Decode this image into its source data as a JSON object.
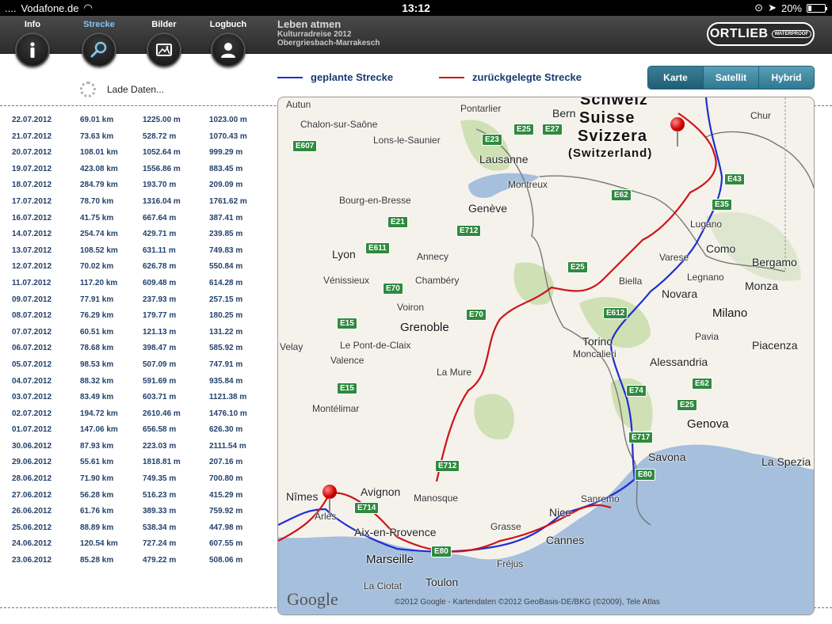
{
  "status": {
    "carrier": "Vodafone.de",
    "time": "13:12",
    "battery": "20%",
    "battery_level": 0.2
  },
  "tabs": [
    {
      "label": "Info",
      "icon": "info-icon"
    },
    {
      "label": "Strecke",
      "icon": "search-icon"
    },
    {
      "label": "Bilder",
      "icon": "pictures-icon"
    },
    {
      "label": "Logbuch",
      "icon": "person-icon"
    }
  ],
  "trip": {
    "title": "Leben atmen",
    "subtitle": "Kulturradreise 2012",
    "route": "Obergriesbach-Marrakesch"
  },
  "logo": {
    "brand": "ORTLIEB",
    "tag": "WATERPROOF"
  },
  "loading": "Lade Daten...",
  "legend": {
    "planned": "geplante Strecke",
    "traveled": "zurückgelegte Strecke",
    "planned_color": "#1f2fd0",
    "traveled_color": "#d0121a"
  },
  "map_types": [
    "Karte",
    "Satellit",
    "Hybrid"
  ],
  "log": [
    [
      "22.07.2012",
      "69.01 km",
      "1225.00 m",
      "1023.00 m"
    ],
    [
      "21.07.2012",
      "73.63 km",
      "528.72 m",
      "1070.43 m"
    ],
    [
      "20.07.2012",
      "108.01 km",
      "1052.64 m",
      "999.29 m"
    ],
    [
      "19.07.2012",
      "423.08 km",
      "1556.86 m",
      "883.45 m"
    ],
    [
      "18.07.2012",
      "284.79 km",
      "193.70 m",
      "209.09 m"
    ],
    [
      "17.07.2012",
      "78.70 km",
      "1316.04 m",
      "1761.62 m"
    ],
    [
      "16.07.2012",
      "41.75 km",
      "667.64 m",
      "387.41 m"
    ],
    [
      "14.07.2012",
      "254.74 km",
      "429.71 m",
      "239.85 m"
    ],
    [
      "13.07.2012",
      "108.52 km",
      "631.11 m",
      "749.83 m"
    ],
    [
      "12.07.2012",
      "70.02 km",
      "626.78 m",
      "550.84 m"
    ],
    [
      "11.07.2012",
      "117.20 km",
      "609.48 m",
      "614.28 m"
    ],
    [
      "09.07.2012",
      "77.91 km",
      "237.93 m",
      "257.15 m"
    ],
    [
      "08.07.2012",
      "76.29 km",
      "179.77 m",
      "180.25 m"
    ],
    [
      "07.07.2012",
      "60.51 km",
      "121.13 m",
      "131.22 m"
    ],
    [
      "06.07.2012",
      "78.68 km",
      "398.47 m",
      "585.92 m"
    ],
    [
      "05.07.2012",
      "98.53 km",
      "507.09 m",
      "747.91 m"
    ],
    [
      "04.07.2012",
      "88.32 km",
      "591.69 m",
      "935.84 m"
    ],
    [
      "03.07.2012",
      "83.49 km",
      "603.71 m",
      "1121.38 m"
    ],
    [
      "02.07.2012",
      "194.72 km",
      "2610.46 m",
      "1476.10 m"
    ],
    [
      "01.07.2012",
      "147.06 km",
      "656.58 m",
      "626.30 m"
    ],
    [
      "30.06.2012",
      "87.93 km",
      "223.03 m",
      "2111.54 m"
    ],
    [
      "29.06.2012",
      "55.61 km",
      "1818.81 m",
      "207.16 m"
    ],
    [
      "28.06.2012",
      "71.90 km",
      "749.35 m",
      "700.80 m"
    ],
    [
      "27.06.2012",
      "56.28 km",
      "516.23 m",
      "415.29 m"
    ],
    [
      "26.06.2012",
      "61.76 km",
      "389.33 m",
      "759.92 m"
    ],
    [
      "25.06.2012",
      "88.89 km",
      "538.34 m",
      "447.98 m"
    ],
    [
      "24.06.2012",
      "120.54 km",
      "727.24 m",
      "607.55 m"
    ],
    [
      "23.06.2012",
      "85.28 km",
      "479.22 m",
      "508.06 m"
    ]
  ],
  "map": {
    "countries": [
      "Schweiz",
      "Suisse",
      "Svizzera",
      "(Switzerland)"
    ],
    "cities": [
      "Autun",
      "Bern",
      "Chur",
      "Chalon-sur-Saône",
      "Pontarlier",
      "Lons-le-Saunier",
      "Lausanne",
      "Montreux",
      "Bourg-en-Bresse",
      "Genève",
      "Lugano",
      "Como",
      "Lyon",
      "Annecy",
      "Varese",
      "Bergamo",
      "Vénissieux",
      "Chambéry",
      "Biella",
      "Legnano",
      "Monza",
      "Voiron",
      "Novara",
      "Milano",
      "Grenoble",
      "Torino",
      "Pavia",
      "Le Pont-de-Claix",
      "Moncalieri",
      "Piacenza",
      "Velay",
      "Valence",
      "Alessandria",
      "La Mure",
      "Montélimar",
      "Genova",
      "Savona",
      "La Spezia",
      "Nîmes",
      "Avignon",
      "Sanremo",
      "Arles",
      "Manosque",
      "Nice",
      "Grasse",
      "Aix-en-Provence",
      "Cannes",
      "Marseille",
      "Fréjus",
      "La Ciotat",
      "Toulon"
    ],
    "roads": [
      "E25",
      "E27",
      "E607",
      "E23",
      "E62",
      "E43",
      "E35",
      "E21",
      "E712",
      "E611",
      "E25",
      "E70",
      "E612",
      "E15",
      "E70",
      "E74",
      "E62",
      "E25",
      "E15",
      "E717",
      "E80",
      "E712",
      "E714",
      "E80"
    ],
    "attribution_logo": "Google",
    "attribution": "©2012 Google - Kartendaten ©2012 GeoBasis-DE/BKG (©2009), Tele Atlas"
  }
}
